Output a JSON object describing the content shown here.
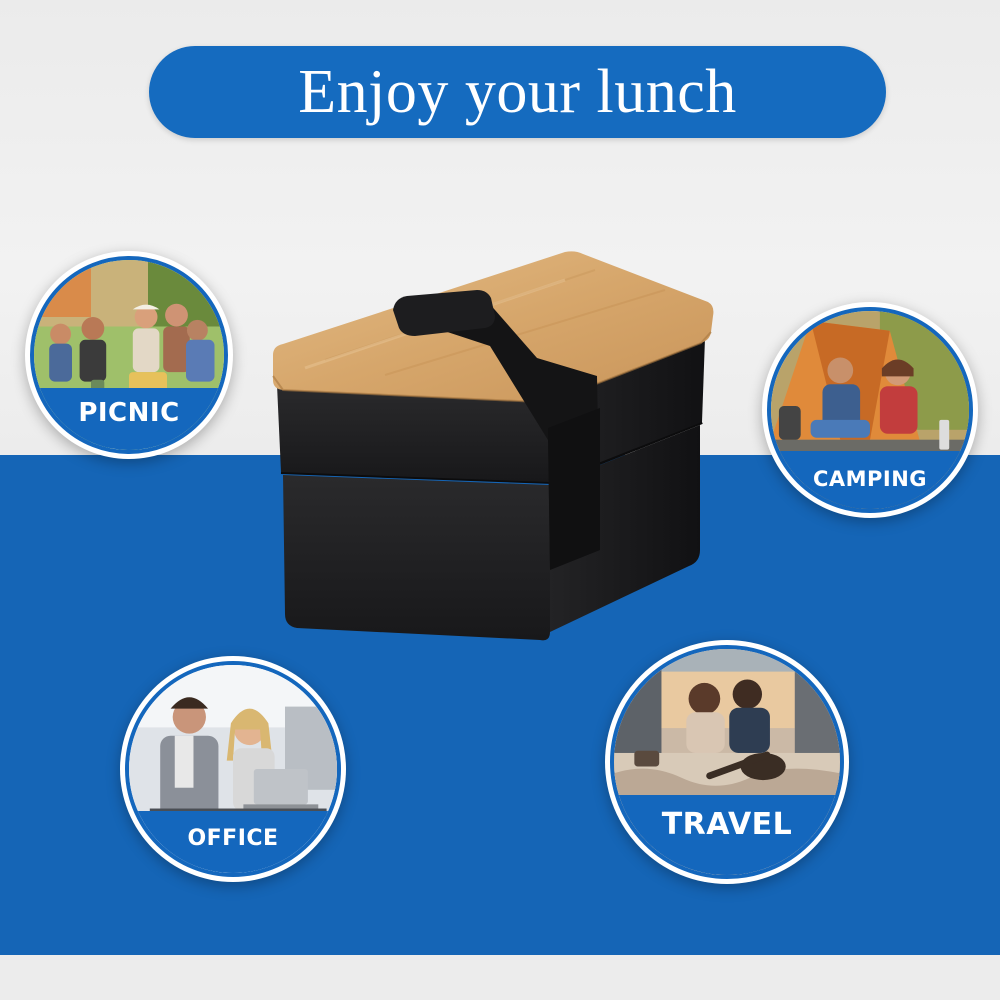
{
  "headline": {
    "text": "Enjoy your lunch"
  },
  "scenes": {
    "picnic": {
      "label": "PICNIC",
      "icon": "picnic-photo"
    },
    "camping": {
      "label": "CAMPING",
      "icon": "camping-photo"
    },
    "office": {
      "label": "OFFICE",
      "icon": "office-photo"
    },
    "travel": {
      "label": "TRAVEL",
      "icon": "travel-photo"
    }
  },
  "product": {
    "icon": "bento-lunch-box"
  },
  "colors": {
    "brand_blue": "#1565b6",
    "pill_blue": "#156bbf",
    "background_grey": "#efefef",
    "box_black": "#1f1f21",
    "bamboo": "#d9aa70"
  }
}
